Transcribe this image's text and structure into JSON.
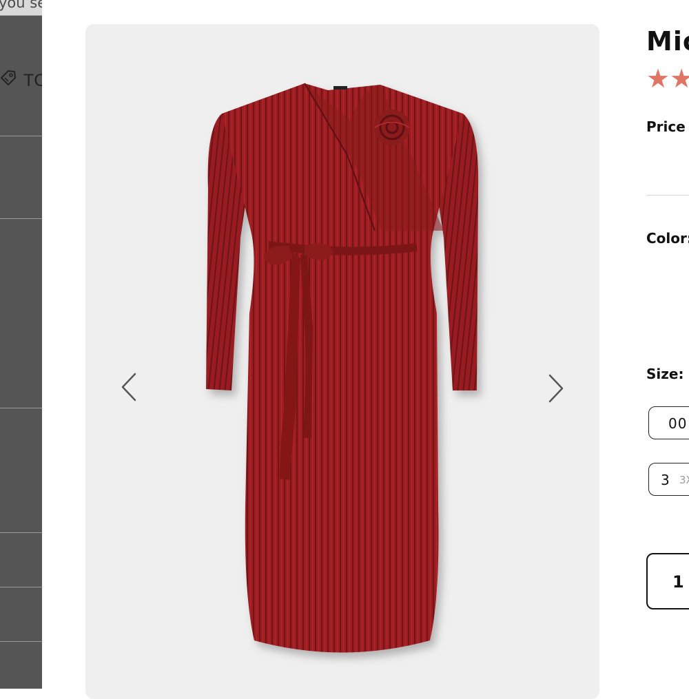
{
  "sidebar": {
    "top_text": "you se",
    "tag_label": "TC"
  },
  "gallery": {
    "image_alt": "Red ribbed wrap midi dress with rosette and tie belt",
    "prev_icon": "chevron-left-icon",
    "next_icon": "chevron-right-icon"
  },
  "product": {
    "title": "Mic",
    "rating_stars": "★★",
    "price_label": "Price",
    "color_label": "Color:",
    "size_label": "Size:",
    "sizes": [
      {
        "main": "00",
        "sub": ""
      },
      {
        "main": "3",
        "sub": "3X"
      }
    ],
    "quantity": "1"
  },
  "colors": {
    "accent_star": "#e07566",
    "dress_red": "#9e1f22",
    "drawer_gray": "#555555",
    "panel_bg": "#efefef"
  }
}
